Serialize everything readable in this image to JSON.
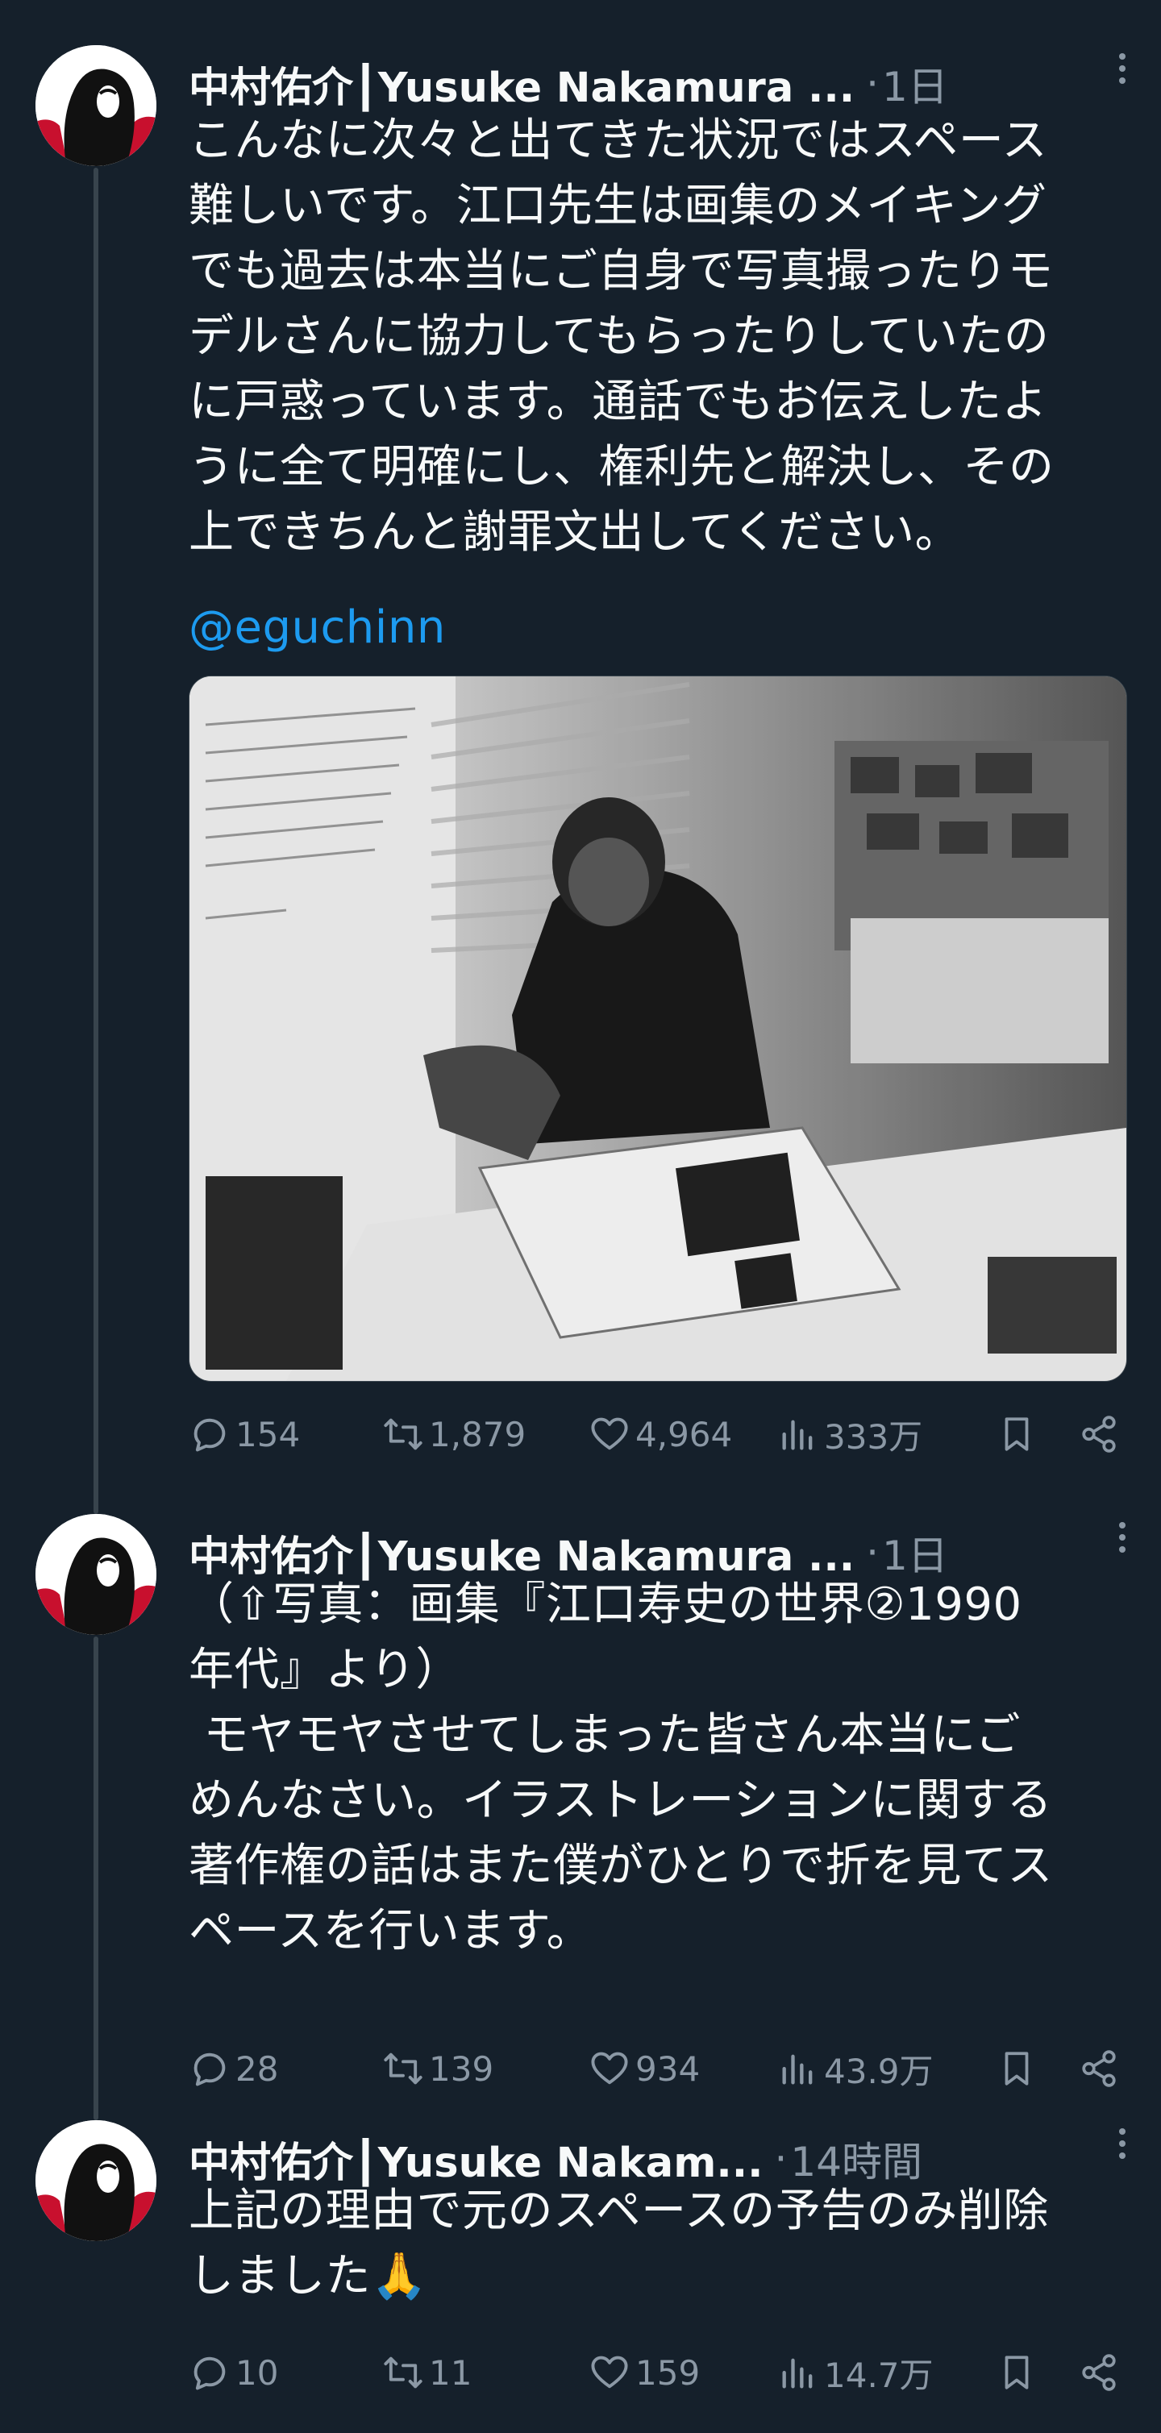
{
  "tweets": [
    {
      "author": "中村佑介┃Yusuke Nakamura ...",
      "separator": "·",
      "time": "1日",
      "text": "こんなに次々と出てきた状況ではスペース\n難しいです。江口先生は画集のメイキング\nでも過去は本当にご自身で写真撮ったりモ\nデルさんに協力してもらったりしていたの\nに戸惑っています。通話でもお伝えしたよ\nうに全て明確にし、権利先と解決し、その\n上できちんと謝罪文出してください。",
      "mention": "@eguchinn",
      "stats": {
        "replies": "154",
        "retweets": "1,879",
        "likes": "4,964",
        "views": "333万"
      }
    },
    {
      "author": "中村佑介┃Yusuke Nakamura ...",
      "separator": "·",
      "time": "1日",
      "text": "（⇧写真：画集『江口寿史の世界②1990\n年代』より）\n モヤモヤさせてしまった皆さん本当にご\nめんなさい。イラストレーションに関する\n著作権の話はまた僕がひとりで折を見てス\nペースを行います。",
      "stats": {
        "replies": "28",
        "retweets": "139",
        "likes": "934",
        "views": "43.9万"
      }
    },
    {
      "author": "中村佑介┃Yusuke Nakam...",
      "separator": "·",
      "time": "14時間",
      "text": "上記の理由で元のスペースの予告のみ削除\nしました🙏",
      "stats": {
        "replies": "10",
        "retweets": "11",
        "likes": "159",
        "views": "14.7万"
      }
    }
  ],
  "icons": {
    "reply": "reply-icon",
    "retweet": "retweet-icon",
    "like": "heart-icon",
    "views": "views-icon",
    "bookmark": "bookmark-icon",
    "share": "share-icon",
    "more": "more-icon"
  },
  "colors": {
    "background": "#15202b",
    "text": "#f7f9f9",
    "secondary": "#8b98a5",
    "link": "#1d9bf0",
    "thread_line": "#38444d"
  }
}
